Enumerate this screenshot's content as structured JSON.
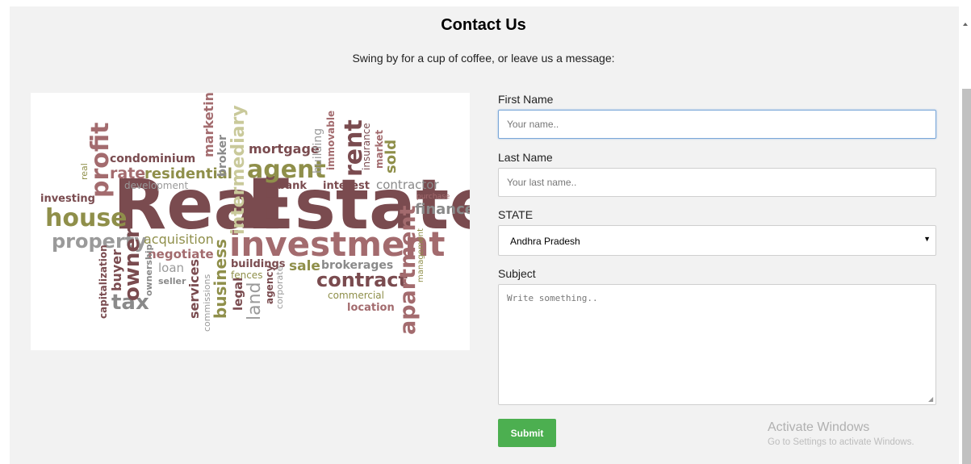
{
  "page": {
    "title": "Contact Us",
    "subtitle": "Swing by for a cup of coffee, or leave us a message:"
  },
  "image": {
    "alt": "Real Estate word cloud",
    "words": {
      "real": "Real",
      "estate": "Estate",
      "investment": "investment",
      "house": "house",
      "property": "property",
      "profit": "profit",
      "agent": "agent",
      "rent": "rent",
      "contract": "contract",
      "apartment": "apartment",
      "finance": "finance",
      "tax": "tax",
      "owner": "owner",
      "business": "business",
      "intermediary": "intermediary",
      "mortgage": "mortgage",
      "condominium": "condominium",
      "rate": "rate",
      "residential": "residential",
      "development": "development",
      "investing": "investing",
      "marketing": "marketing",
      "broker": "broker",
      "building": "building",
      "immovable": "immovable",
      "insurance": "insurance",
      "market": "market",
      "sold": "sold",
      "bank": "bank",
      "interest": "interest",
      "contractor": "contractor",
      "purchase": "purchase",
      "acquisition": "acquisition",
      "negotiate": "negotiate",
      "loan": "loan",
      "seller": "seller",
      "buildings": "buildings",
      "fences": "fences",
      "sale": "sale",
      "brokerages": "brokerages",
      "commercial": "commercial",
      "location": "location",
      "management": "management",
      "capitalization": "capitalization",
      "buyer": "buyer",
      "ownership": "ownership",
      "services": "services",
      "commissions": "commissions",
      "legal": "legal",
      "land": "land",
      "agency": "agency",
      "corporate": "corporate",
      "real_small": "real"
    }
  },
  "form": {
    "first_name_label": "First Name",
    "first_name_placeholder": "Your name..",
    "last_name_label": "Last Name",
    "last_name_placeholder": "Your last name..",
    "state_label": "STATE",
    "state_value": "Andhra Pradesh",
    "subject_label": "Subject",
    "subject_placeholder": "Write something..",
    "submit_label": "Submit"
  },
  "watermark": {
    "title": "Activate Windows",
    "subtitle": "Go to Settings to activate Windows."
  },
  "colors": {
    "maroon": "#7a4b4f",
    "olive": "#8f8f4a",
    "gray": "#8a8a8a",
    "rose": "#a36b6e",
    "submit": "#4caf50"
  }
}
